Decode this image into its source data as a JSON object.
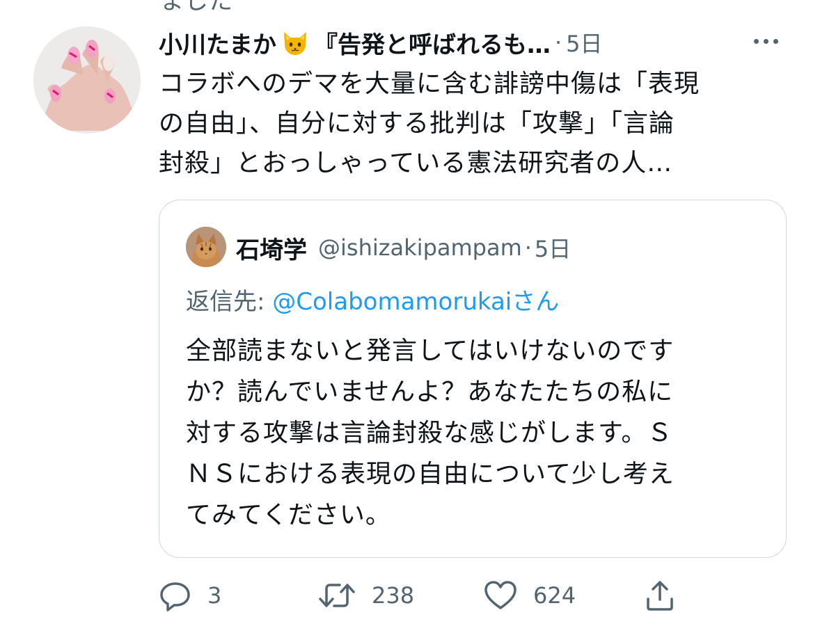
{
  "top_cut_text": "ました",
  "tweet": {
    "display_name": "小川たまか",
    "name_suffix": "『告発と呼ばれるも…",
    "emoji_name": "cat-face-icon",
    "separator": "·",
    "time": "5日",
    "text_lines": [
      "コラボへのデマを大量に含む誹謗中傷は「表現",
      "の自由」、自分に対する批判は「攻撃」「言論",
      "封殺」とおっしゃっている憲法研究者の人…"
    ]
  },
  "quote": {
    "display_name": "石埼学",
    "handle": "@ishizakipampam",
    "separator": "·",
    "time": "5日",
    "reply_prefix": "返信先: ",
    "reply_handle": "@Colabomamorukai",
    "reply_suffix": "さん",
    "text_lines": [
      "全部読まないと発言してはいけないのです",
      "か？読んでいませんよ？あなたたちの私に",
      "対する攻撃は言論封殺な感じがします。Ｓ",
      "ＮＳにおける表現の自由について少し考え",
      "てみてください。"
    ]
  },
  "actions": {
    "reply_count": "3",
    "retweet_count": "238",
    "like_count": "624",
    "icons": [
      "reply-icon",
      "retweet-icon",
      "like-icon",
      "share-icon"
    ]
  },
  "colors": {
    "text": "#0f1419",
    "secondary": "#536471",
    "link": "#1d9bf0",
    "border": "#cfd9de"
  }
}
